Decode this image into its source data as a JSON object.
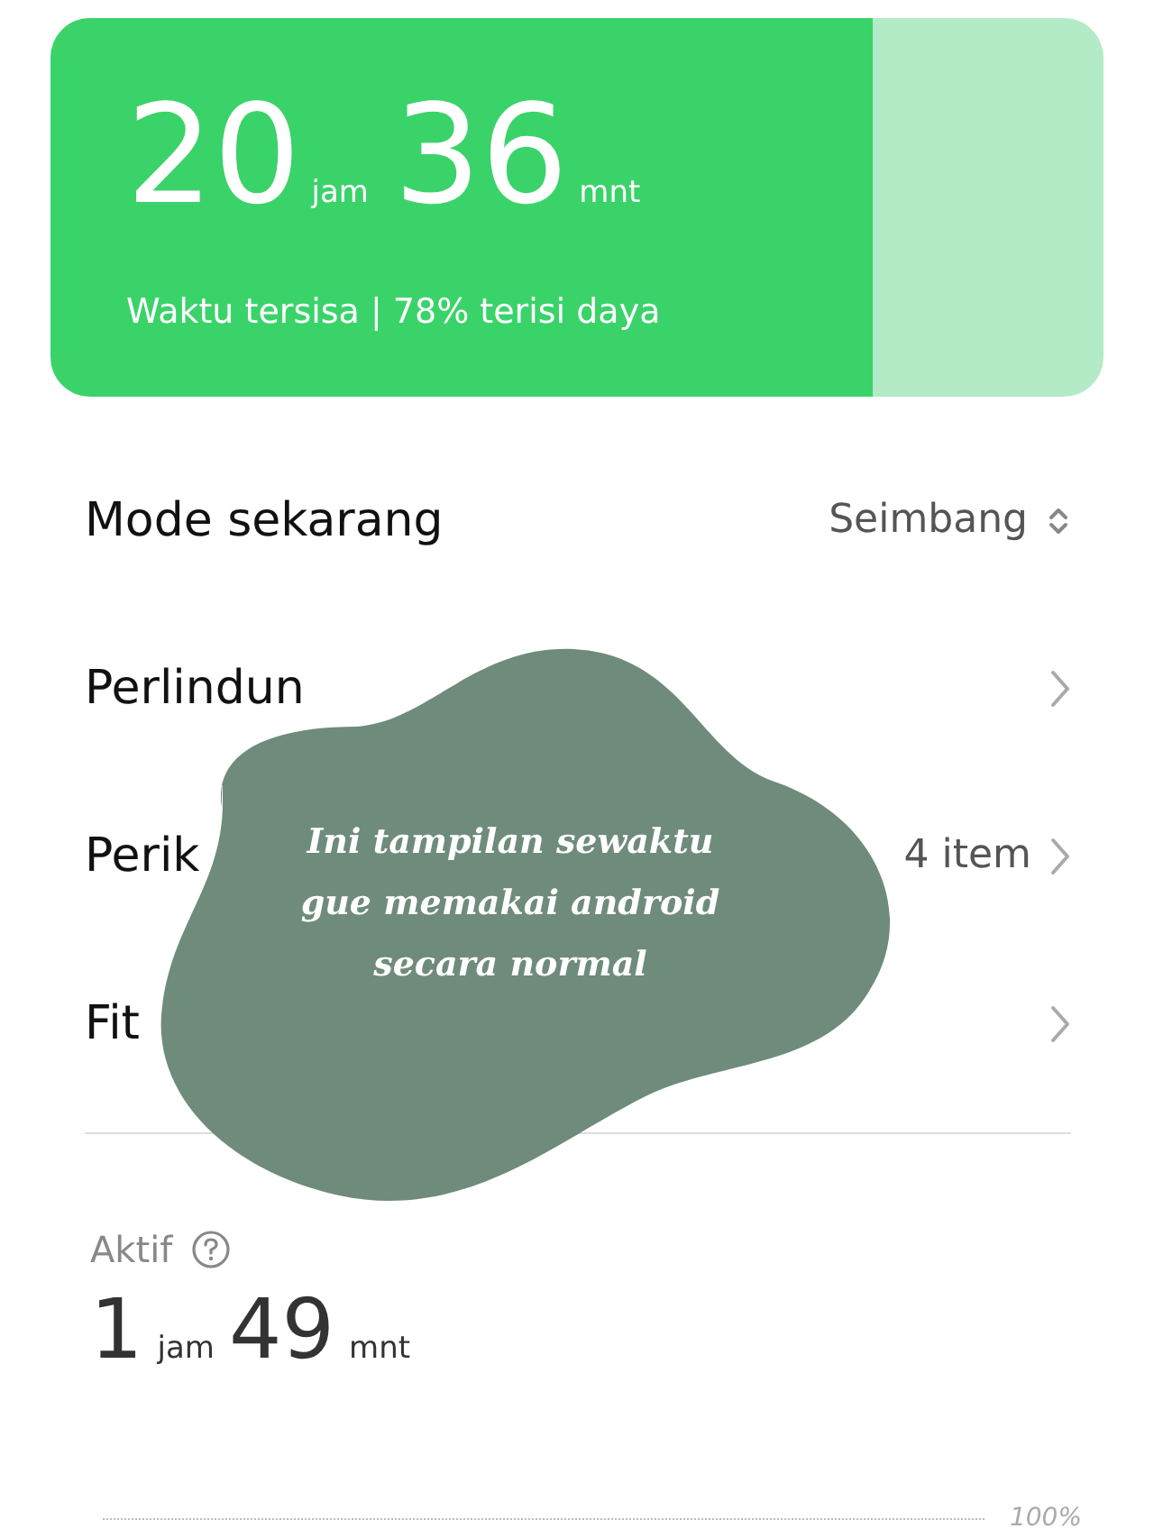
{
  "battery_card": {
    "level": 0.78,
    "hours": "20",
    "hours_unit": "jam",
    "minutes": "36",
    "minutes_unit": "mnt",
    "caption": "Waktu tersisa | 78% terisi daya"
  },
  "rows": [
    {
      "kind": "select",
      "label": "Mode sekarang",
      "value": "Seimbang"
    },
    {
      "kind": "link",
      "label": "Perlindun"
    },
    {
      "kind": "link",
      "label": "Perik",
      "value": "4 item"
    },
    {
      "kind": "link",
      "label": "Fit"
    }
  ],
  "active": {
    "label": "Aktif",
    "hours": "1",
    "hours_unit": "jam",
    "minutes": "49",
    "minutes_unit": "mnt"
  },
  "chart_gridline": {
    "label": "100%"
  },
  "overlay": {
    "lines": [
      "Ini tampilan sewaktu",
      "gue memakai android",
      "secara normal"
    ]
  }
}
